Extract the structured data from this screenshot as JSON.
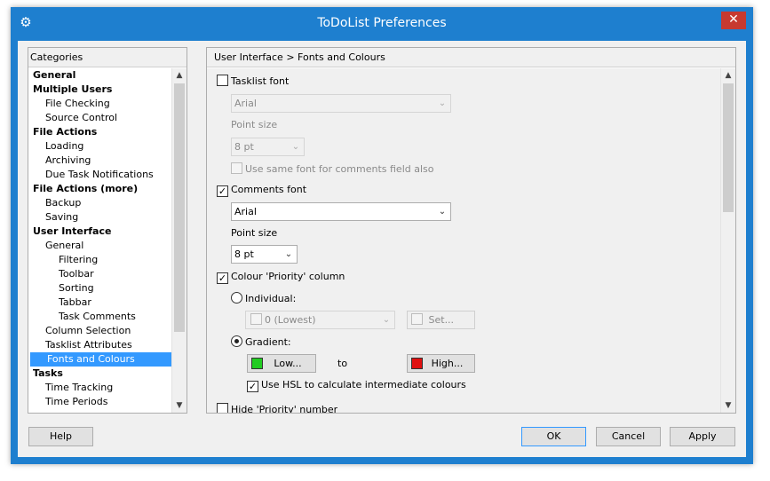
{
  "window": {
    "title": "ToDoList Preferences",
    "app_icon": "gear-icon",
    "close_glyph": "✕",
    "accent_color": "#1e7fcf"
  },
  "categories": {
    "header": "Categories",
    "items": [
      {
        "label": "General",
        "level": 0
      },
      {
        "label": "Multiple Users",
        "level": 0
      },
      {
        "label": "File Checking",
        "level": 1
      },
      {
        "label": "Source Control",
        "level": 1
      },
      {
        "label": "File Actions",
        "level": 0
      },
      {
        "label": "Loading",
        "level": 1
      },
      {
        "label": "Archiving",
        "level": 1
      },
      {
        "label": "Due Task Notifications",
        "level": 1
      },
      {
        "label": "File Actions (more)",
        "level": 0
      },
      {
        "label": "Backup",
        "level": 1
      },
      {
        "label": "Saving",
        "level": 1
      },
      {
        "label": "User Interface",
        "level": 0
      },
      {
        "label": "General",
        "level": 1
      },
      {
        "label": "Filtering",
        "level": 2
      },
      {
        "label": "Toolbar",
        "level": 2
      },
      {
        "label": "Sorting",
        "level": 2
      },
      {
        "label": "Tabbar",
        "level": 2
      },
      {
        "label": "Task Comments",
        "level": 2
      },
      {
        "label": "Column Selection",
        "level": 1
      },
      {
        "label": "Tasklist Attributes",
        "level": 1
      },
      {
        "label": "Fonts and Colours",
        "level": 1,
        "selected": true
      },
      {
        "label": "Tasks",
        "level": 0
      },
      {
        "label": "Time Tracking",
        "level": 1
      },
      {
        "label": "Time Periods",
        "level": 1
      }
    ]
  },
  "page": {
    "breadcrumb": "User Interface > Fonts and Colours",
    "tasklist_font": {
      "label": "Tasklist font",
      "checked": false
    },
    "tasklist_font_name": "Arial",
    "tasklist_point_size_label": "Point size",
    "tasklist_point_size": "8 pt",
    "same_font_comments": {
      "label": "Use same font for comments field also",
      "checked": false
    },
    "comments_font": {
      "label": "Comments font",
      "checked": true
    },
    "comments_font_name": "Arial",
    "comments_point_size_label": "Point size",
    "comments_point_size": "8 pt",
    "colour_priority": {
      "label": "Colour 'Priority' column",
      "checked": true
    },
    "individual_label": "Individual:",
    "individual_value": "0 (Lowest)",
    "set_button": "Set...",
    "gradient_label": "Gradient:",
    "low_button": "Low...",
    "low_color": "#22cc22",
    "to_label": "to",
    "high_button": "High...",
    "high_color": "#e01010",
    "use_hsl": {
      "label": "Use HSL to calculate intermediate colours",
      "checked": true
    },
    "partial_next_label": "Hide 'Priority' number"
  },
  "footer": {
    "help": "Help",
    "ok": "OK",
    "cancel": "Cancel",
    "apply": "Apply"
  }
}
